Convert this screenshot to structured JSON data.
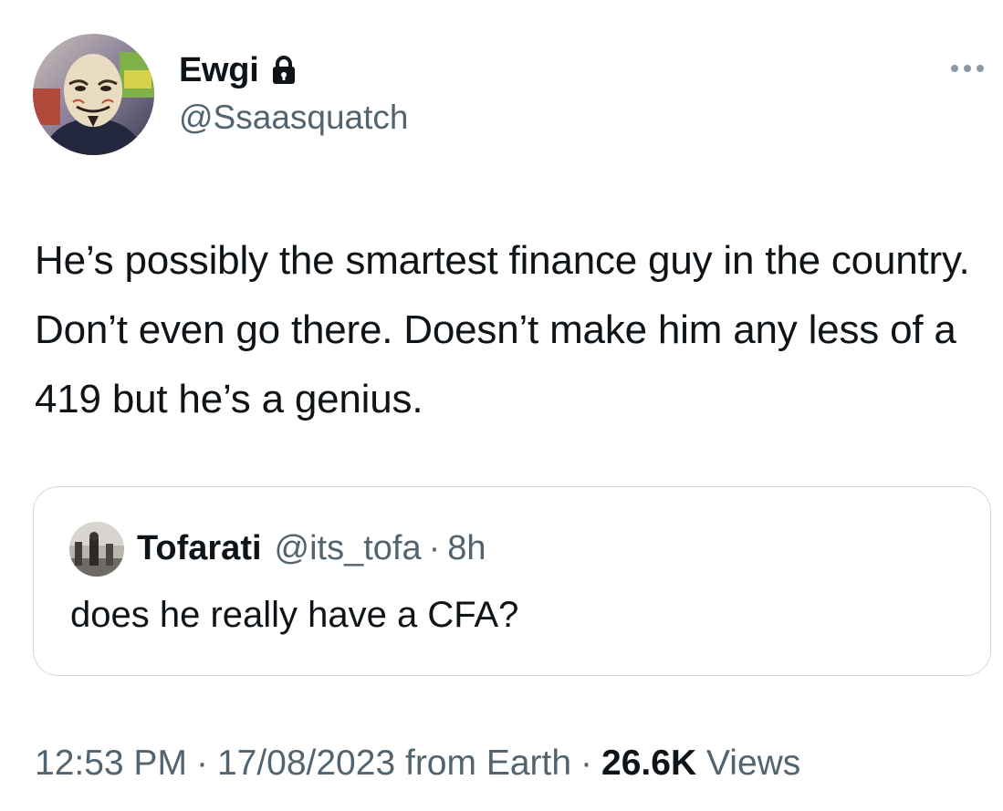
{
  "author": {
    "display_name": "Ewgi",
    "handle": "@Ssaasquatch",
    "protected_icon": "lock-icon",
    "avatar_icon": "mask-avatar"
  },
  "tweet": {
    "text": "He’s possibly the smartest finance guy in the country. Don’t even go there. Doesn’t make him any less of a 419 but he’s a genius."
  },
  "quote": {
    "display_name": "Tofarati",
    "handle": "@its_tofa",
    "separator": "·",
    "time": "8h",
    "text": "does he really have a CFA?"
  },
  "meta": {
    "time": "12:53 PM",
    "separator": "·",
    "date": "17/08/2023",
    "source": "from Earth",
    "views_count": "26.6K",
    "views_label": "Views"
  },
  "colors": {
    "text_primary": "#0f1419",
    "text_secondary": "#536471",
    "border": "#cfd9de"
  },
  "more_icon": "more-horizontal-icon"
}
